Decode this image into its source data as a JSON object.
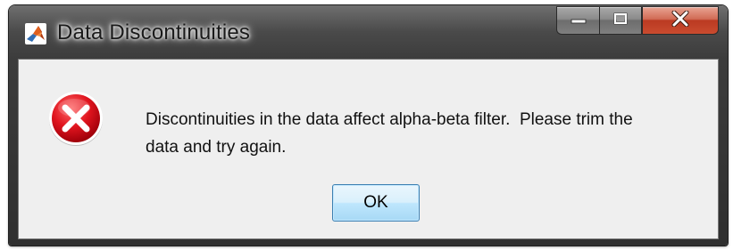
{
  "window": {
    "title": "Data Discontinuities",
    "app_icon": "matlab-icon"
  },
  "caption_buttons": {
    "minimize_icon": "minimize-icon",
    "maximize_icon": "maximize-icon",
    "close_icon": "close-icon"
  },
  "dialog": {
    "icon": "error-icon",
    "message_line1": "Discontinuities in the data affect alpha-beta filter.  Please trim the",
    "message_line2": "data and try again.",
    "ok_label": "OK"
  },
  "colors": {
    "close_button": "#c94b2f",
    "error_icon": "#e0141e",
    "ok_button_border": "#3c7fb1"
  }
}
